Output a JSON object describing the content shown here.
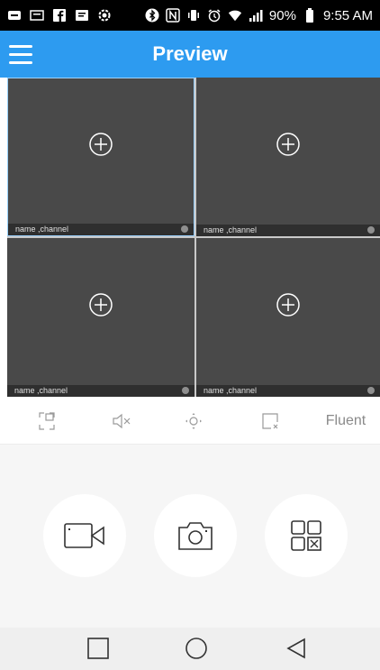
{
  "status_bar": {
    "battery_percent": "90%",
    "time": "9:55 AM",
    "left_icons": [
      "message-icon",
      "news-icon",
      "facebook-icon",
      "notes-icon",
      "settings-gear-icon"
    ],
    "right_icons": [
      "bluetooth-icon",
      "nfc-icon",
      "vibrate-icon",
      "alarm-icon",
      "wifi-icon",
      "signal-icon",
      "battery-icon"
    ]
  },
  "app_bar": {
    "title": "Preview"
  },
  "grid": {
    "cells": [
      {
        "label": "name ,channel"
      },
      {
        "label": "name ,channel"
      },
      {
        "label": "name ,channel"
      },
      {
        "label": "name ,channel"
      }
    ]
  },
  "controls": {
    "fluent_label": "Fluent"
  },
  "colors": {
    "accent": "#2d9bf0",
    "cell_bg": "#494949",
    "selected_border": "#9ad2ff"
  }
}
